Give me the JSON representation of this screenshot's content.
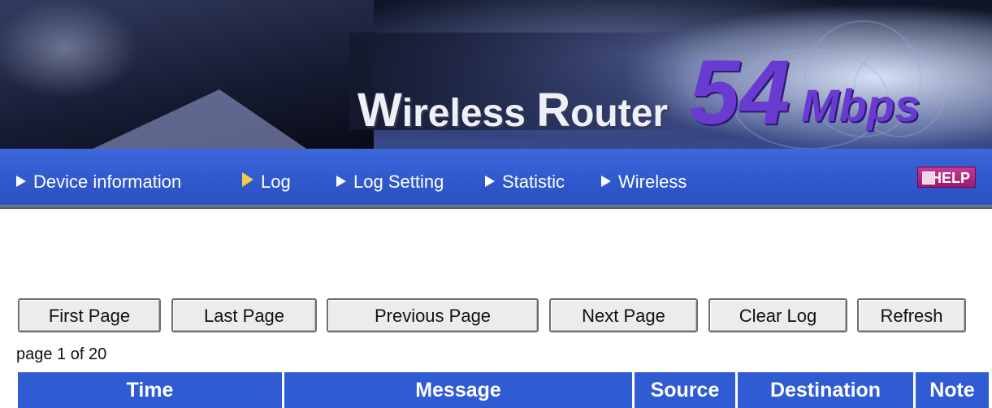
{
  "banner": {
    "title_first": "W",
    "title_rest_1": "ireless ",
    "title_r": "R",
    "title_rest_2": "outer",
    "speed": "54",
    "unit": "Mbps"
  },
  "nav": {
    "items": [
      {
        "label": "Device information"
      },
      {
        "label": "Log"
      },
      {
        "label": "Log Setting"
      },
      {
        "label": "Statistic"
      },
      {
        "label": "Wireless"
      }
    ],
    "help_label": "HELP",
    "active_color": "#f4c84a"
  },
  "toolbar": {
    "first_page": "First Page",
    "last_page": "Last Page",
    "previous_page": "Previous Page",
    "next_page": "Next Page",
    "clear_log": "Clear Log",
    "refresh": "Refresh"
  },
  "pagination": {
    "text": "page 1 of 20"
  },
  "table": {
    "columns": [
      "Time",
      "Message",
      "Source",
      "Destination",
      "Note"
    ],
    "header_color": "#2f5bd3"
  },
  "colors": {
    "nav_bg": "#2e57cb",
    "help_bg": "#b02a84",
    "brand_purple": "#6a3bd0"
  }
}
